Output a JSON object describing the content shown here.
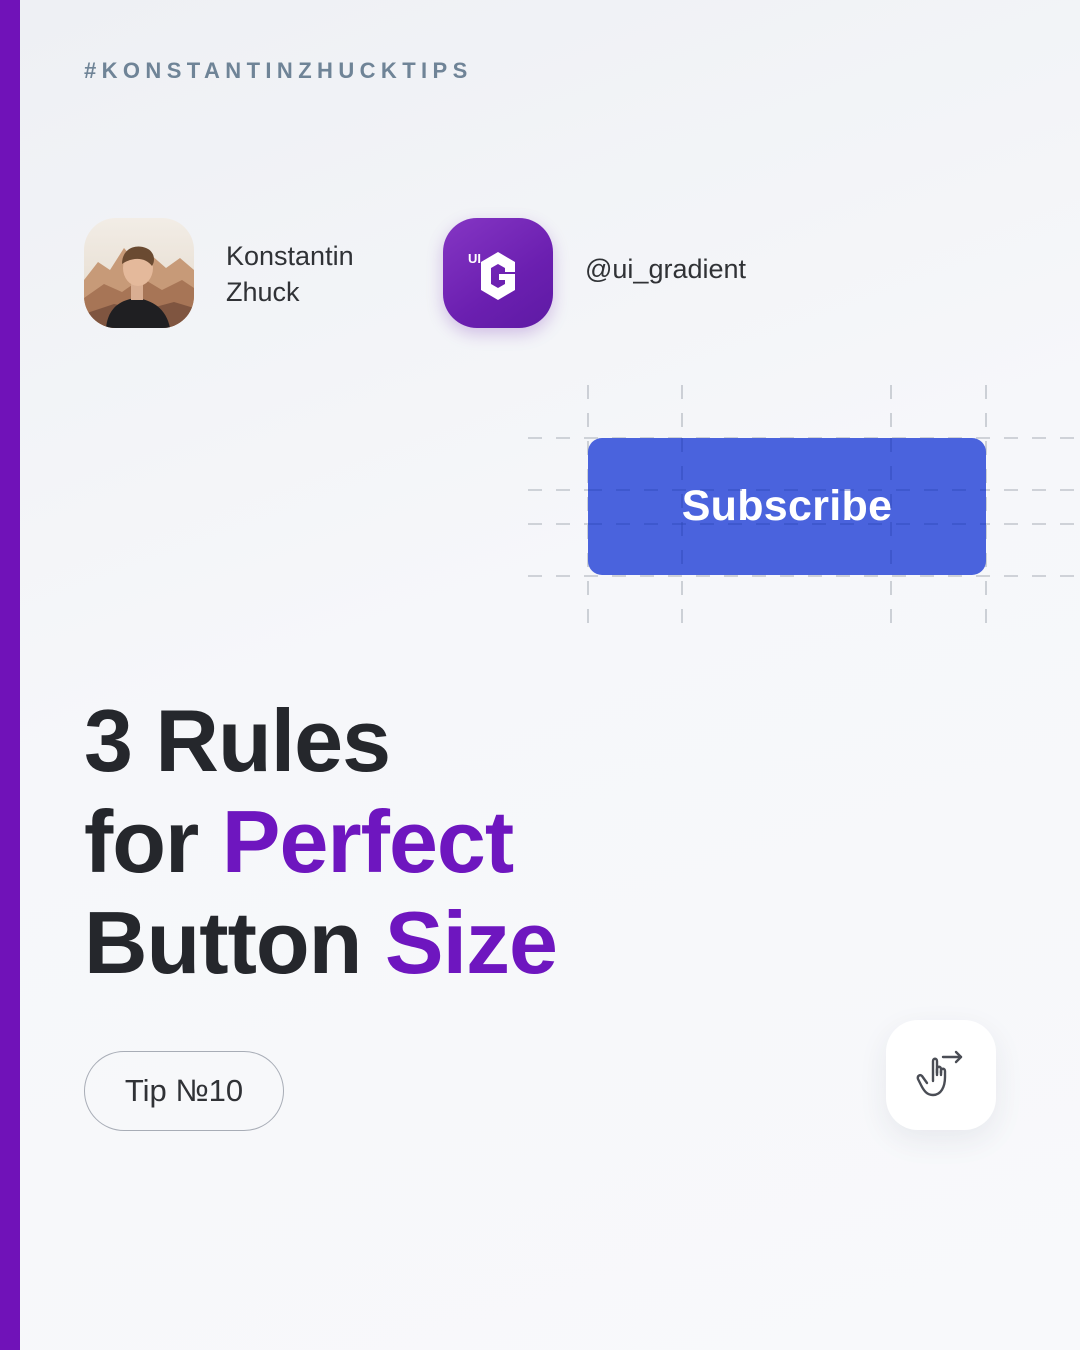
{
  "hashtag": "#KONSTANTINZHUCKTIPS",
  "author": {
    "name_line1": "Konstantin",
    "name_line2": "Zhuck",
    "avatar_icon": "author-photo"
  },
  "brand": {
    "logo_text": "UI",
    "logo_icon": "ui-gradient-logo",
    "handle": "@ui_gradient"
  },
  "demo_button": {
    "label": "Subscribe"
  },
  "headline": {
    "line1": "3 Rules",
    "line2_plain": "for ",
    "line2_accent": "Perfect",
    "line3_plain": "Button ",
    "line3_accent": "Size"
  },
  "tip_badge": "Tip №10",
  "swipe_icon": "swipe-hand-icon",
  "colors": {
    "accent_purple": "#6e16bf",
    "side_bar": "#7012b8",
    "button_blue": "#4a63dd",
    "text_dark": "#25272c",
    "hashtag_gray": "#6f8497"
  }
}
